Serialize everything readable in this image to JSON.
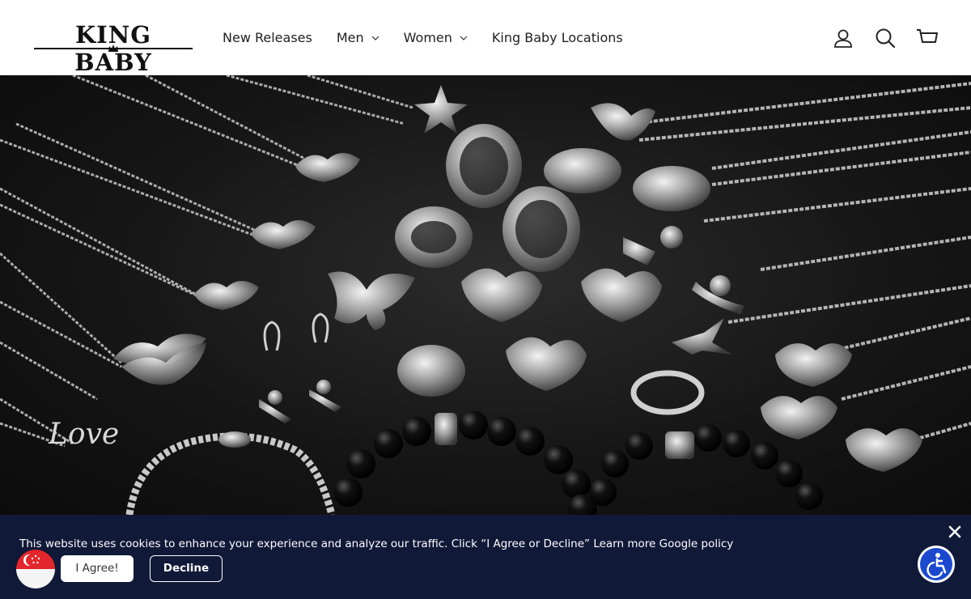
{
  "brand": {
    "name": "KING BABY"
  },
  "nav": {
    "items": [
      {
        "label": "New Releases",
        "has_dropdown": false
      },
      {
        "label": "Men",
        "has_dropdown": true
      },
      {
        "label": "Women",
        "has_dropdown": true
      },
      {
        "label": "King Baby Locations",
        "has_dropdown": false
      }
    ]
  },
  "header_icons": [
    "account-icon",
    "search-icon",
    "cart-icon"
  ],
  "hero": {
    "alt": ""
  },
  "cookie_banner": {
    "message": "This website uses cookies to enhance your experience and analyze our traffic. Click “I Agree or Decline”",
    "learn_more": "Learn more",
    "policy_link": "Google policy",
    "agree_label": "I Agree!",
    "decline_label": "Decline"
  },
  "colors": {
    "banner_bg": "#101938",
    "accessibility_blue": "#1a49d0",
    "flag_red": "#e2262b"
  }
}
